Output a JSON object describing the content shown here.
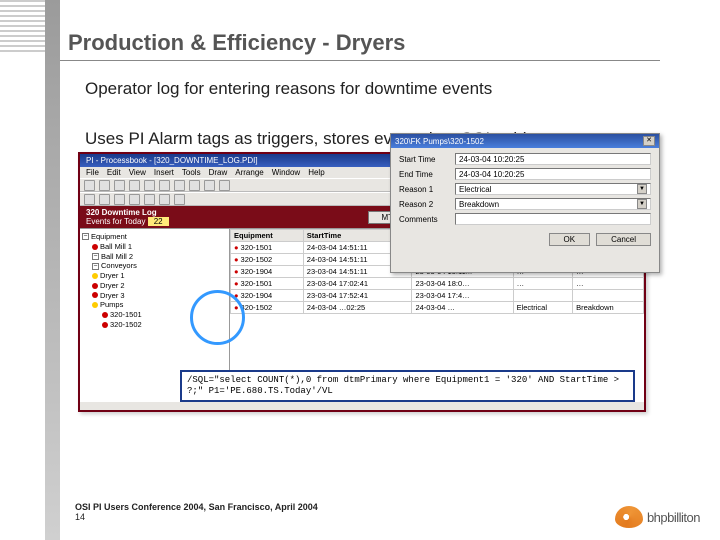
{
  "title": "Production & Efficiency - Dryers",
  "bullet1": "Operator log for entering reasons for downtime events",
  "bullet2": "Uses PI Alarm tags as triggers, stores events in a SQL table",
  "app": {
    "titlebar": "PI - Processbook - [320_DOWNTIME_LOG.PDI]",
    "menus": [
      "File",
      "Edit",
      "View",
      "Insert",
      "Tools",
      "Draw",
      "Arrange",
      "Window",
      "Help"
    ],
    "band_title": "320 Downtime Log",
    "band_sub": "Events for Today",
    "band_count": "22",
    "band_btn": "MTD Report",
    "tree": [
      {
        "lvl": 0,
        "type": "box",
        "label": "Equipment"
      },
      {
        "lvl": 1,
        "type": "red",
        "label": "Ball Mill 1"
      },
      {
        "lvl": 1,
        "type": "box",
        "label": "Ball Mill 2"
      },
      {
        "lvl": 1,
        "type": "box",
        "label": "Conveyors"
      },
      {
        "lvl": 1,
        "type": "yel",
        "label": "Dryer 1"
      },
      {
        "lvl": 1,
        "type": "red",
        "label": "Dryer 2"
      },
      {
        "lvl": 1,
        "type": "red",
        "label": "Dryer 3"
      },
      {
        "lvl": 1,
        "type": "yel",
        "label": "Pumps"
      },
      {
        "lvl": 2,
        "type": "red",
        "label": "320-1501"
      },
      {
        "lvl": 2,
        "type": "red",
        "label": "320-1502"
      }
    ],
    "columns": [
      "Equipment",
      "StartTime",
      "EndTime",
      "",
      ""
    ],
    "rows": [
      [
        "320-1501",
        "24-03-04 14:51:11",
        "",
        "",
        ""
      ],
      [
        "320-1502",
        "24-03-04 14:51:11",
        "",
        "",
        ""
      ],
      [
        "320-1904",
        "23-03-04 14:51:11",
        "23-03-04 15:11:..",
        "…",
        "…"
      ],
      [
        "320-1501",
        "23-03-04 17:02:41",
        "23-03-04 18:0…",
        "…",
        "…"
      ],
      [
        "320-1904",
        "23-03-04 17:52:41",
        "23-03-04 17:4…",
        "",
        ""
      ],
      [
        "320-1502",
        "24-03-04 …02:25",
        "24-03-04 …",
        "Electrical",
        "Breakdown"
      ]
    ]
  },
  "dialog": {
    "title": "320\\FK Pumps\\320-1502",
    "start_label": "Start Time",
    "start_val": "24-03-04  10:20:25",
    "end_label": "End Time",
    "end_val": "24-03-04  10:20:25",
    "reason1_label": "Reason 1",
    "reason1_val": "Electrical",
    "reason2_label": "Reason 2",
    "reason2_val": "Breakdown",
    "comments_label": "Comments",
    "comments_val": "",
    "ok": "OK",
    "cancel": "Cancel"
  },
  "sql": "/SQL=\"select COUNT(*),0 from dtmPrimary where Equipment1 = '320' AND StartTime > ?;\" P1='PE.680.TS.Today'/VL",
  "footer_line": "OSI PI Users Conference 2004, San Francisco, April 2004",
  "footer_num": "14",
  "logo_text": "bhpbilliton"
}
